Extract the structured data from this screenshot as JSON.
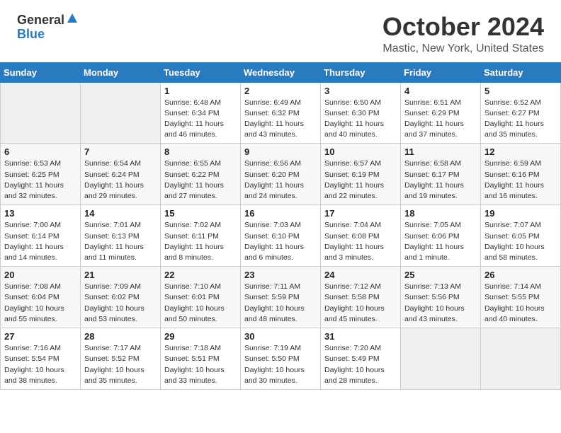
{
  "header": {
    "logo_general": "General",
    "logo_blue": "Blue",
    "title": "October 2024",
    "location": "Mastic, New York, United States"
  },
  "days_of_week": [
    "Sunday",
    "Monday",
    "Tuesday",
    "Wednesday",
    "Thursday",
    "Friday",
    "Saturday"
  ],
  "weeks": [
    [
      {
        "day": "",
        "info": ""
      },
      {
        "day": "",
        "info": ""
      },
      {
        "day": "1",
        "info": "Sunrise: 6:48 AM\nSunset: 6:34 PM\nDaylight: 11 hours and 46 minutes."
      },
      {
        "day": "2",
        "info": "Sunrise: 6:49 AM\nSunset: 6:32 PM\nDaylight: 11 hours and 43 minutes."
      },
      {
        "day": "3",
        "info": "Sunrise: 6:50 AM\nSunset: 6:30 PM\nDaylight: 11 hours and 40 minutes."
      },
      {
        "day": "4",
        "info": "Sunrise: 6:51 AM\nSunset: 6:29 PM\nDaylight: 11 hours and 37 minutes."
      },
      {
        "day": "5",
        "info": "Sunrise: 6:52 AM\nSunset: 6:27 PM\nDaylight: 11 hours and 35 minutes."
      }
    ],
    [
      {
        "day": "6",
        "info": "Sunrise: 6:53 AM\nSunset: 6:25 PM\nDaylight: 11 hours and 32 minutes."
      },
      {
        "day": "7",
        "info": "Sunrise: 6:54 AM\nSunset: 6:24 PM\nDaylight: 11 hours and 29 minutes."
      },
      {
        "day": "8",
        "info": "Sunrise: 6:55 AM\nSunset: 6:22 PM\nDaylight: 11 hours and 27 minutes."
      },
      {
        "day": "9",
        "info": "Sunrise: 6:56 AM\nSunset: 6:20 PM\nDaylight: 11 hours and 24 minutes."
      },
      {
        "day": "10",
        "info": "Sunrise: 6:57 AM\nSunset: 6:19 PM\nDaylight: 11 hours and 22 minutes."
      },
      {
        "day": "11",
        "info": "Sunrise: 6:58 AM\nSunset: 6:17 PM\nDaylight: 11 hours and 19 minutes."
      },
      {
        "day": "12",
        "info": "Sunrise: 6:59 AM\nSunset: 6:16 PM\nDaylight: 11 hours and 16 minutes."
      }
    ],
    [
      {
        "day": "13",
        "info": "Sunrise: 7:00 AM\nSunset: 6:14 PM\nDaylight: 11 hours and 14 minutes."
      },
      {
        "day": "14",
        "info": "Sunrise: 7:01 AM\nSunset: 6:13 PM\nDaylight: 11 hours and 11 minutes."
      },
      {
        "day": "15",
        "info": "Sunrise: 7:02 AM\nSunset: 6:11 PM\nDaylight: 11 hours and 8 minutes."
      },
      {
        "day": "16",
        "info": "Sunrise: 7:03 AM\nSunset: 6:10 PM\nDaylight: 11 hours and 6 minutes."
      },
      {
        "day": "17",
        "info": "Sunrise: 7:04 AM\nSunset: 6:08 PM\nDaylight: 11 hours and 3 minutes."
      },
      {
        "day": "18",
        "info": "Sunrise: 7:05 AM\nSunset: 6:06 PM\nDaylight: 11 hours and 1 minute."
      },
      {
        "day": "19",
        "info": "Sunrise: 7:07 AM\nSunset: 6:05 PM\nDaylight: 10 hours and 58 minutes."
      }
    ],
    [
      {
        "day": "20",
        "info": "Sunrise: 7:08 AM\nSunset: 6:04 PM\nDaylight: 10 hours and 55 minutes."
      },
      {
        "day": "21",
        "info": "Sunrise: 7:09 AM\nSunset: 6:02 PM\nDaylight: 10 hours and 53 minutes."
      },
      {
        "day": "22",
        "info": "Sunrise: 7:10 AM\nSunset: 6:01 PM\nDaylight: 10 hours and 50 minutes."
      },
      {
        "day": "23",
        "info": "Sunrise: 7:11 AM\nSunset: 5:59 PM\nDaylight: 10 hours and 48 minutes."
      },
      {
        "day": "24",
        "info": "Sunrise: 7:12 AM\nSunset: 5:58 PM\nDaylight: 10 hours and 45 minutes."
      },
      {
        "day": "25",
        "info": "Sunrise: 7:13 AM\nSunset: 5:56 PM\nDaylight: 10 hours and 43 minutes."
      },
      {
        "day": "26",
        "info": "Sunrise: 7:14 AM\nSunset: 5:55 PM\nDaylight: 10 hours and 40 minutes."
      }
    ],
    [
      {
        "day": "27",
        "info": "Sunrise: 7:16 AM\nSunset: 5:54 PM\nDaylight: 10 hours and 38 minutes."
      },
      {
        "day": "28",
        "info": "Sunrise: 7:17 AM\nSunset: 5:52 PM\nDaylight: 10 hours and 35 minutes."
      },
      {
        "day": "29",
        "info": "Sunrise: 7:18 AM\nSunset: 5:51 PM\nDaylight: 10 hours and 33 minutes."
      },
      {
        "day": "30",
        "info": "Sunrise: 7:19 AM\nSunset: 5:50 PM\nDaylight: 10 hours and 30 minutes."
      },
      {
        "day": "31",
        "info": "Sunrise: 7:20 AM\nSunset: 5:49 PM\nDaylight: 10 hours and 28 minutes."
      },
      {
        "day": "",
        "info": ""
      },
      {
        "day": "",
        "info": ""
      }
    ]
  ]
}
